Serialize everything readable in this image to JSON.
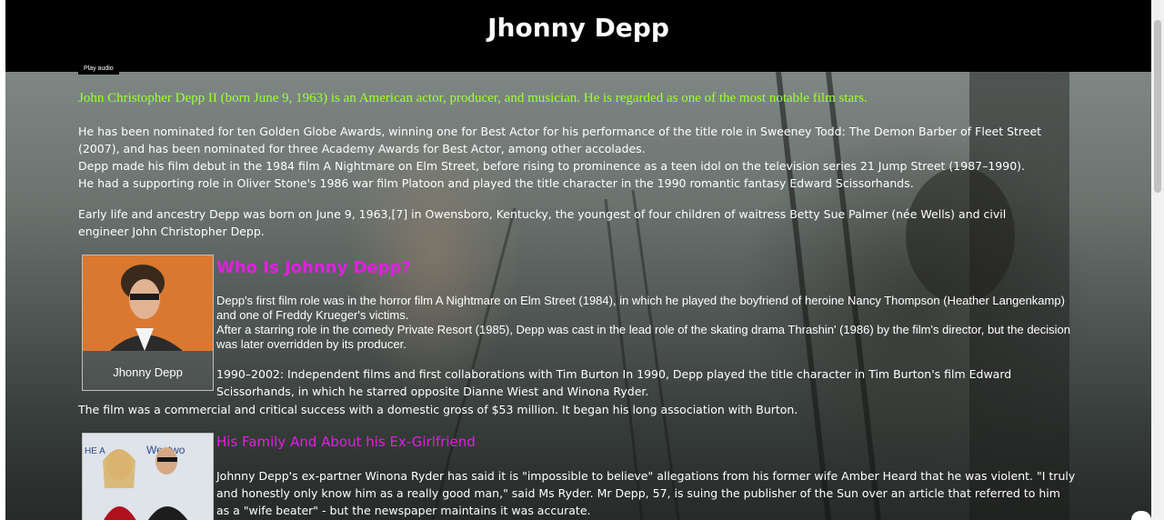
{
  "header": {
    "title": "Jhonny Depp"
  },
  "audio": {
    "play_label": "Play audio"
  },
  "intro": "John Christopher Depp II (born June 9, 1963) is an American actor, producer, and musician. He is regarded as one of the most notable film stars.",
  "career": [
    "He has been nominated for ten Golden Globe Awards, winning one for Best Actor for his performance of the title role in Sweeney Todd: The Demon Barber of Fleet Street (2007), and has been nominated for three Academy Awards for Best Actor, among other accolades.",
    "Depp made his film debut in the 1984 film A Nightmare on Elm Street, before rising to prominence as a teen idol on the television series 21 Jump Street (1987–1990).",
    "He had a supporting role in Oliver Stone's 1986 war film Platoon and played the title character in the 1990 romantic fantasy Edward Scissorhands."
  ],
  "early_life": "Early life and ancestry Depp was born on June 9, 1963,[7] in Owensboro, Kentucky, the youngest of four children of waitress Betty Sue Palmer (née Wells) and civil engineer John Christopher Depp.",
  "section1": {
    "card_caption": "Jhonny Depp",
    "title": "Who Is Johnny Depp?",
    "p1": "Depp's first film role was in the horror film A Nightmare on Elm Street (1984), in which he played the boyfriend of heroine Nancy Thompson (Heather Langenkamp) and one of Freddy Krueger's victims.",
    "p2": "After a starring role in the comedy Private Resort (1985), Depp was cast in the lead role of the skating drama Thrashin' (1986) by the film's director, but the decision was later overridden by its producer.",
    "p3": "1990–2002: Independent films and first collaborations with Tim Burton In 1990, Depp played the title character in Tim Burton's film Edward Scissorhands, in which he starred opposite Dianne Wiest and Winona Ryder.",
    "p4": "The film was a commercial and critical success with a domestic gross of $53 million. It began his long association with Burton."
  },
  "section2": {
    "title": "His Family And About his Ex-Girlfriend",
    "p1": "Johnny Depp's ex-partner Winona Ryder has said it is \"impossible to believe\" allegations from his former wife Amber Heard that he was violent. \"I truly and honestly only know him as a really good man,\" said Ms Ryder. Mr Depp, 57, is suing the publisher of the Sun over an article that referred to him as a \"wife beater\" - but the newspaper maintains it was accurate."
  },
  "colors": {
    "header_bg": "#000000",
    "intro_text": "#9cff3a",
    "section_title": "#e21fe2",
    "body_text": "#ffffff"
  }
}
